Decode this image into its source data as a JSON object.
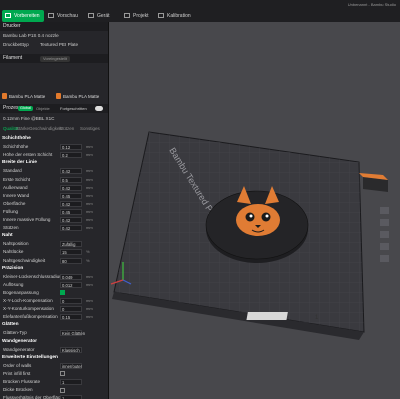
{
  "window_title": "Unbenannt - Bambu Studio",
  "tabs": [
    {
      "label": "Vorbereiten",
      "active": true
    },
    {
      "label": "Vorschau"
    },
    {
      "label": "Gerät"
    },
    {
      "label": "Projekt"
    },
    {
      "label": "Kalibration"
    }
  ],
  "printer": {
    "section": "Drucker",
    "name": "Bambu Lab P1S 0.4 nozzle",
    "plate_label": "Druckbetttyp",
    "plate_value": "Textured PEI Plate"
  },
  "filament": {
    "section": "Filament",
    "dropdown": "Voreingestellt",
    "items": [
      {
        "index": "1",
        "name": "Bambu PLA Matte"
      },
      {
        "index": "2",
        "name": "Bambu PLA Matte"
      }
    ],
    "color": "#e37a2c"
  },
  "process": {
    "label": "Prozess",
    "badge": "Global",
    "object_label": "Objekte",
    "advanced_label": "Fortgeschritten",
    "preset": "0.12mm Fine @BBL X1C",
    "subtabs": [
      "Qualität",
      "Stärke",
      "Geschwindigkeit",
      "Stützen",
      "Sonstiges"
    ]
  },
  "settings": {
    "layer_group": "Schichthöhe",
    "layer_rows": [
      {
        "label": "Schichthöhe",
        "value": "0.12",
        "unit": "mm"
      },
      {
        "label": "Höhe der ersten Schicht",
        "value": "0.2",
        "unit": "mm"
      }
    ],
    "width_group": "Breite der Linie",
    "width_rows": [
      {
        "label": "Standard",
        "value": "0.42",
        "unit": "mm"
      },
      {
        "label": "Erste Schicht",
        "value": "0.5",
        "unit": "mm"
      },
      {
        "label": "Außenwand",
        "value": "0.42",
        "unit": "mm"
      },
      {
        "label": "Innere Wand",
        "value": "0.45",
        "unit": "mm"
      },
      {
        "label": "Oberfläche",
        "value": "0.42",
        "unit": "mm"
      },
      {
        "label": "Füllung",
        "value": "0.45",
        "unit": "mm"
      },
      {
        "label": "Innere massive Füllung",
        "value": "0.42",
        "unit": "mm"
      },
      {
        "label": "Stützen",
        "value": "0.42",
        "unit": "mm"
      }
    ],
    "seam_group": "Naht",
    "seam_rows": [
      {
        "label": "Nahtposition",
        "value": "Zufällig",
        "unit": ""
      },
      {
        "label": "Nahtlücke",
        "value": "15",
        "unit": "%"
      },
      {
        "label": "Nahtgeschwindigkeit",
        "value": "80",
        "unit": "%"
      }
    ],
    "precision_group": "Präzision",
    "precision_rows": [
      {
        "label": "Kleiner-Lückenschlussradius",
        "value": "0.049",
        "unit": "mm"
      },
      {
        "label": "Auflösung",
        "value": "0.012",
        "unit": "mm"
      },
      {
        "label": "Bogenanpassung",
        "value": "",
        "unit": ""
      },
      {
        "label": "X-Y-Loch-Kompensation",
        "value": "0",
        "unit": "mm"
      },
      {
        "label": "X-Y-Konturkompensation",
        "value": "0",
        "unit": "mm"
      },
      {
        "label": "Elefantenfußkompensation",
        "value": "0.15",
        "unit": "mm"
      }
    ],
    "ironing_group": "Glätten",
    "ironing_rows": [
      {
        "label": "Glätten-Typ",
        "value": "Kein Glätten",
        "unit": ""
      }
    ],
    "wall_gen_group": "Wandgenerator",
    "wall_gen_rows": [
      {
        "label": "Wandgenerator",
        "value": "Klassisch",
        "unit": ""
      }
    ],
    "advanced_group": "Erweiterte Einstellungen",
    "advanced_rows": [
      {
        "label": "Order of walls",
        "value": "inner/outer",
        "unit": ""
      },
      {
        "label": "Print infill first",
        "value": "",
        "unit": ""
      },
      {
        "label": "Brücken Flussrate",
        "value": "1",
        "unit": ""
      },
      {
        "label": "Dicke Brücken",
        "value": "",
        "unit": ""
      },
      {
        "label": "Flussverhältnis der Oberfläche",
        "value": "1",
        "unit": ""
      },
      {
        "label": "Flussverhältnis der ersten Schicht",
        "value": "1",
        "unit": ""
      }
    ]
  },
  "viewport": {
    "plate_label": "Bambu Textured PEI Plate",
    "plate_number": "1"
  }
}
